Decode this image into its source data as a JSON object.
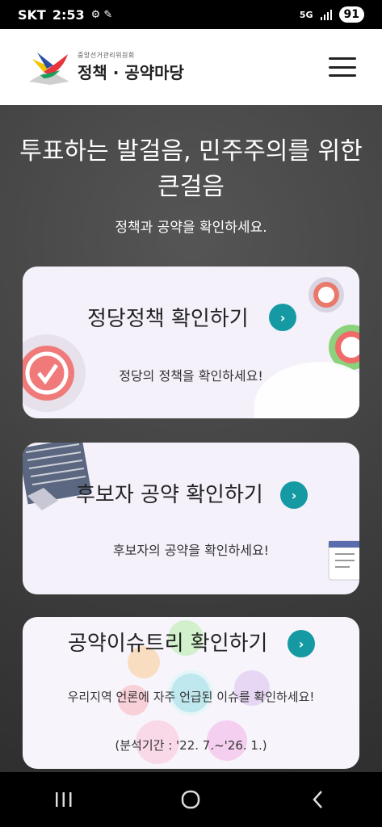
{
  "status": {
    "carrier": "SKT",
    "time": "2:53",
    "network": "5G",
    "battery": "91"
  },
  "header": {
    "org_name": "중앙선거관리위원회",
    "site_title": "정책 · 공약마당"
  },
  "hero": {
    "title": "투표하는 발걸음, 민주주의를 위한 큰걸음",
    "subtitle": "정책과 공약을 확인하세요."
  },
  "cards": [
    {
      "title": "정당정책 확인하기",
      "desc": "정당의 정책을 확인하세요!",
      "arrow": "›"
    },
    {
      "title": "후보자 공약 확인하기",
      "desc": "후보자의 공약을 확인하세요!",
      "arrow": "›"
    },
    {
      "title": "공약이슈트리 확인하기",
      "desc": "우리지역 언론에 자주 언급된 이슈를 확인하세요!",
      "period": "(분석기간 : '22. 7.~'26. 1.)",
      "arrow": "›"
    }
  ]
}
